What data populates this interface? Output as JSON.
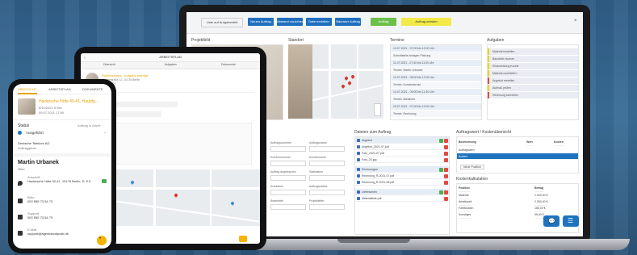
{
  "laptop": {
    "toolbar": {
      "menu_label": "Liste auf Aufgabenfelt",
      "buttons": [
        "Neuen Auftrag",
        "Abstand vorziehen",
        "Datei erstellen",
        "Nächster Auftrag",
        "Auftrag",
        "Auftrag ernsten"
      ],
      "button_colors": [
        "#1f6fbf",
        "#1f6fbf",
        "#1f6fbf",
        "#1f6fbf",
        "#6cc04a",
        "#f2ea48"
      ]
    },
    "sections": {
      "project": "Projektbild",
      "location": "Standort",
      "appointments": "Termine",
      "tasks": "Aufgaben",
      "files": "Dateien zum Auftrag",
      "orders": "Auftragswert / Kostenübersicht",
      "costs": "Kostenkalkulation"
    },
    "appointments": [
      "10.07.2021 - 07:00 bis 10:00 Uhr",
      "Schnittstelle Anlagen Planung",
      "11.07.2021 - 07:30 bis 11:00 Uhr",
      "Termin: Martin Urbanek",
      "12.07.2021 - 08:00 bis 12:00 Uhr",
      "Termin: Kundentermin",
      "14.07.2021 - 09:00 bis 11:30 Uhr",
      "Termin: Abnahme",
      "15.07.2021 - 07:00 bis 10:00 Uhr",
      "Termin: Rechnung"
    ],
    "tasks": [
      "Material bestellen",
      "Baustelle räumen",
      "Rückmeldung Kunde",
      "Material nachliefern",
      "Angebot erstellen",
      "Aufmaß prüfen",
      "Rechnung schreiben"
    ],
    "form_labels": [
      "Auftragsnummer",
      "Auftragsname",
      "Kundennummer",
      "Kundenname",
      "Auftrag angelegt am",
      "Startdatum",
      "Enddatum",
      "Auftragsstatus",
      "Bearbeiter",
      "Projektleiter"
    ],
    "files": [
      "Angebot",
      "Angebot_2021-07.pdf",
      "Foto_2021-07.pdf",
      "Foto_20.jpg",
      "Rechnungen",
      "Rechnung_R-2021-07.pdf",
      "Rechnung_R-2021-08.pdf",
      "Lieferschein",
      "Materialliste.pdf"
    ],
    "orders": {
      "headers": [
        "Bezeichnung",
        "Wert",
        "Kosten"
      ],
      "rows": [
        [
          "Auftragswert",
          "",
          ""
        ],
        [
          "Kosten",
          "",
          ""
        ]
      ],
      "add_label": "Neue Position"
    },
    "costs": {
      "headers": [
        "Position",
        "Betrag"
      ],
      "rows": [
        [
          "Material",
          "1.250,00 €"
        ],
        [
          "Arbeitszeit",
          "2.350,00 €"
        ],
        [
          "Fahrtkosten",
          "180,00 €"
        ],
        [
          "Sonstiges",
          "95,00 €"
        ]
      ]
    }
  },
  "tablet": {
    "title": "ARBEITSPLAN",
    "tabs": [
      "Übersicht",
      "Aufgaben",
      "Dokumente"
    ],
    "job_title": "Rückmeldung · Aufgabe erledigt",
    "address": "Musterstraße 12, 10178 Berlin",
    "date": "08.07.2021"
  },
  "phone": {
    "tabs": [
      "ÜBERSICHT",
      "ARBEITSPLAN",
      "DOKUMENTE"
    ],
    "job_title": "Hackesche Höfe 40-41, Hauptg...",
    "job_subtitle": "8/10/2021 5 Min",
    "job_date": "09.07.2021 17:00",
    "status_label": "Status",
    "status_link": "Auftrag in Arbeit",
    "status_value": "Ausgeführt",
    "team_line1": "Deutsche Telekom AG",
    "team_line2": "Auftraggeber",
    "contact_name": "Martin Urbanek",
    "contact_city": "Mitte",
    "address_label": "Anschrift",
    "address_value": "Hackesche Höfe 40-41, 10178 Berlin, D. 0.5",
    "phone_label": "Büro",
    "phone_value": "000 555 73 54 73",
    "support_label": "Support",
    "support_value": "000 555 73 54 73",
    "email_label": "E-Mail",
    "email_value": "support@agentdevdiposk.de"
  }
}
